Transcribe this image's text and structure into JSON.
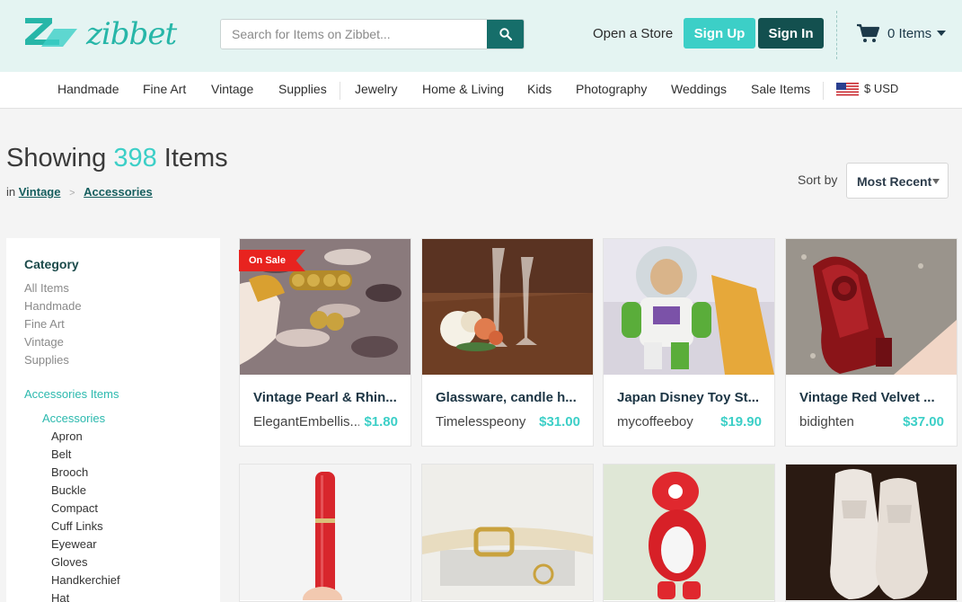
{
  "header": {
    "logo_text": "zibbet",
    "search_placeholder": "Search for Items on Zibbet...",
    "open_store": "Open a Store",
    "sign_up": "Sign Up",
    "sign_in": "Sign In",
    "cart_label": "0 Items"
  },
  "nav": {
    "items": [
      "Handmade",
      "Fine Art",
      "Vintage",
      "Supplies",
      "Jewelry",
      "Home & Living",
      "Kids",
      "Photography",
      "Weddings",
      "Sale Items"
    ],
    "currency": "$ USD"
  },
  "listing": {
    "showing_prefix": "Showing",
    "count": "398",
    "showing_suffix": "Items",
    "breadcrumb_in": "in",
    "breadcrumb_sep": ">",
    "breadcrumb": [
      "Vintage",
      "Accessories"
    ],
    "sort_label": "Sort by",
    "sort_value": "Most Recent"
  },
  "sidebar": {
    "category_title": "Category",
    "categories": [
      "All Items",
      "Handmade",
      "Fine Art",
      "Vintage",
      "Supplies"
    ],
    "section_title": "Accessories Items",
    "active": "Accessories",
    "subcategories": [
      "Apron",
      "Belt",
      "Brooch",
      "Buckle",
      "Compact",
      "Cuff Links",
      "Eyewear",
      "Gloves",
      "Handkerchief",
      "Hat"
    ]
  },
  "products": [
    {
      "title": "Vintage Pearl & Rhin...",
      "shop": "ElegantEmbellis...",
      "price": "$1.80",
      "badge": "On Sale"
    },
    {
      "title": "Glassware, candle h...",
      "shop": "Timelesspeony",
      "price": "$31.00"
    },
    {
      "title": "Japan Disney Toy St...",
      "shop": "mycoffeeboy",
      "price": "$19.90"
    },
    {
      "title": "Vintage Red Velvet ...",
      "shop": "bidighten",
      "price": "$37.00"
    }
  ],
  "colors": {
    "accent": "#3ccfc7",
    "dark_teal": "#13504f",
    "header_bg": "#e4f4f2",
    "sale": "#e8231f"
  },
  "icons": [
    "zibbet-logo-icon",
    "search-icon",
    "cart-icon",
    "us-flag-icon"
  ]
}
